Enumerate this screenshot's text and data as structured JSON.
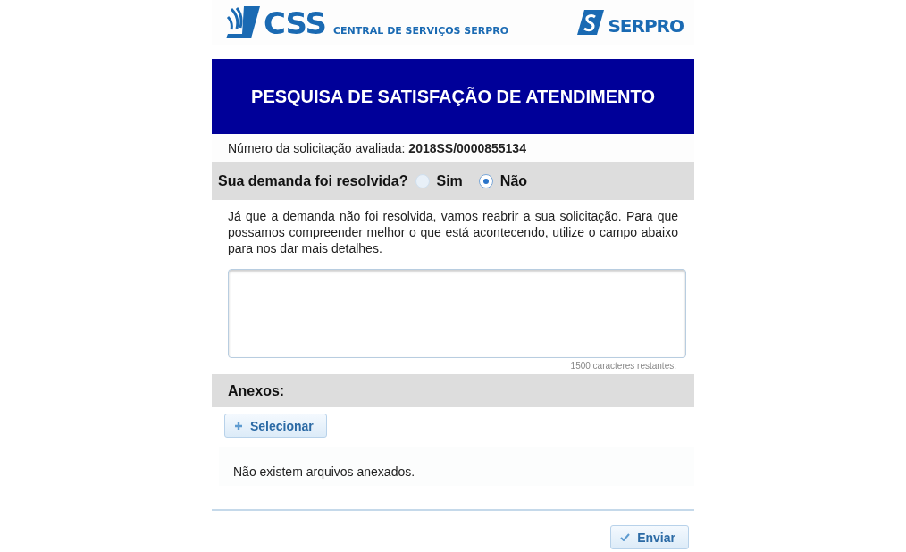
{
  "header": {
    "logo_text": "CSS",
    "logo_subtitle": "CENTRAL DE SERVIÇOS SERPRO",
    "partner_logo_text": "SERPRO"
  },
  "banner": {
    "title": "PESQUISA DE SATISFAÇÃO DE ATENDIMENTO"
  },
  "request": {
    "label": "Número da solicitação avaliada:",
    "value": "2018SS/0000855134"
  },
  "question": {
    "label": "Sua demanda foi resolvida?",
    "options": [
      {
        "label": "Sim",
        "selected": false
      },
      {
        "label": "Não",
        "selected": true
      }
    ]
  },
  "instructions": "Já que a demanda não foi resolvida, vamos reabrir a sua solicitação. Para que possamos compreender melhor o que está acontecendo, utilize o campo abaixo para nos dar mais detalhes.",
  "comment": {
    "counter": "1500 caracteres restantes."
  },
  "attachments": {
    "title": "Anexos:",
    "select_button": "Selecionar",
    "empty_message": "Não existem arquivos anexados."
  },
  "submit_button": "Enviar"
}
